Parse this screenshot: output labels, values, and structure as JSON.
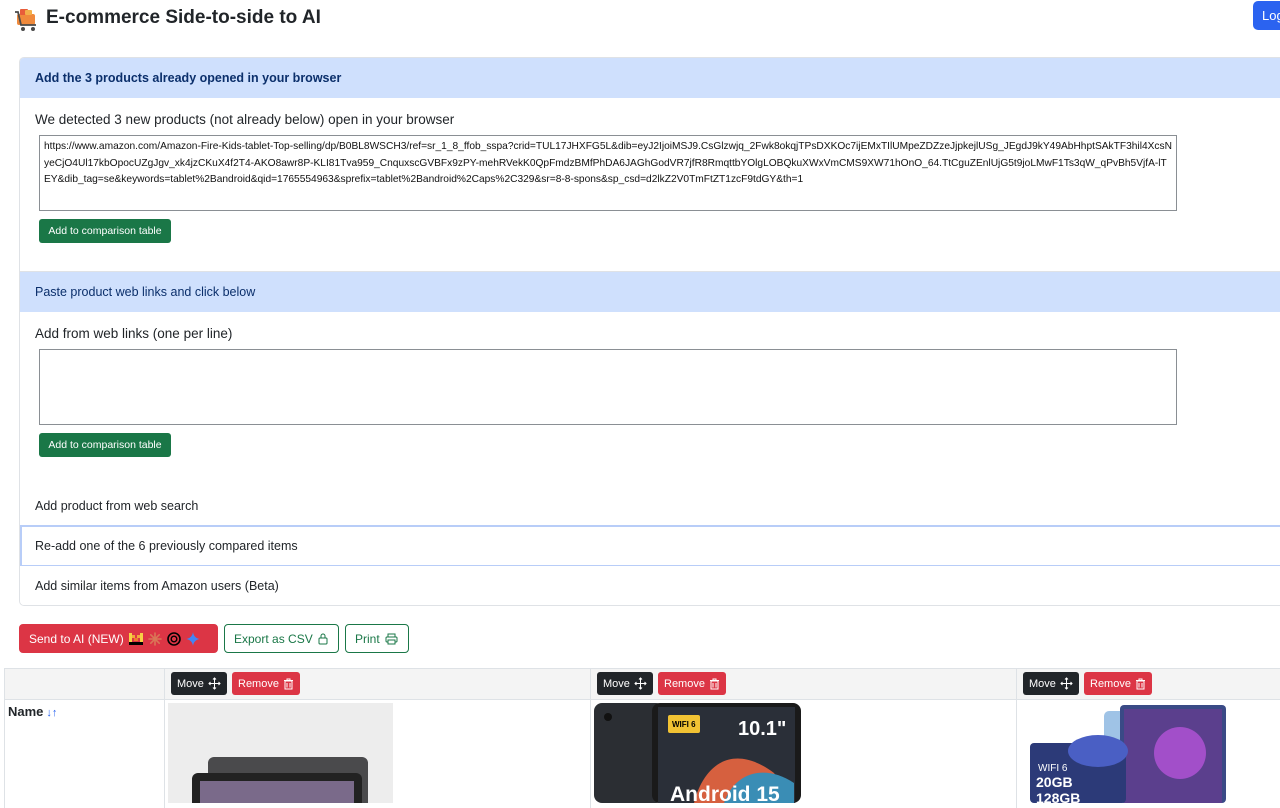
{
  "header": {
    "title": "E-commerce Side-to-side to AI",
    "login_label": "Login"
  },
  "sections": {
    "opened": {
      "heading": "Add the 3 products already opened in your browser",
      "detected_text": "We detected 3 new products (not already below) open in your browser",
      "urls": "https://www.amazon.com/Amazon-Fire-Kids-tablet-Top-selling/dp/B0BL8WSCH3/ref=sr_1_8_ffob_sspa?crid=TUL17JHXFG5L&dib=eyJ2IjoiMSJ9.CsGlzwjq_2Fwk8okqjTPsDXKOc7ijEMxTIlUMpeZDZzeJjpkejlUSg_JEgdJ9kY49AbHhptSAkTF3hil4XcsNyeCjO4Ul17kbOpocUZgJgv_xk4jzCKuX4f2T4-AKO8awr8P-KLI81Tva959_CnquxscGVBFx9zPY-mehRVekK0QpFmdzBMfPhDA6JAGhGodVR7jfR8RmqttbYOlgLOBQkuXWxVmCMS9XW71hOnO_64.TtCguZEnlUjG5t9joLMwF1Ts3qW_qPvBh5VjfA-lTEY&dib_tag=se&keywords=tablet%2Bandroid&qid=1765554963&sprefix=tablet%2Bandroid%2Caps%2C329&sr=8-8-spons&sp_csd=d2lkZ2V0TmFtZT1zcF9tdGY&th=1",
      "button_label": "Add to comparison table"
    },
    "paste": {
      "heading": "Paste product web links and click below",
      "label": "Add from web links (one per line)",
      "value": "",
      "button_label": "Add to comparison table"
    },
    "web_search": {
      "heading": "Add product from web search"
    },
    "readd": {
      "heading": "Re-add one of the 6 previously compared items"
    },
    "similar": {
      "heading": "Add similar items from Amazon users (Beta)"
    }
  },
  "toolbar": {
    "send_ai_label": "Send to AI (NEW)",
    "export_label": "Export as CSV",
    "print_label": "Print"
  },
  "table": {
    "move_label": "Move",
    "remove_label": "Remove",
    "name_header": "Name",
    "products": [
      {
        "badge": "",
        "size": ""
      },
      {
        "badge": "WIFI 6",
        "size": "10.1\"",
        "os": "Android 15"
      },
      {
        "badge": "WIFI 6",
        "ram": "20GB",
        "rom": "128GB"
      }
    ]
  },
  "colors": {
    "accent": "#2b63f0",
    "green": "#1a7747",
    "red": "#dc3545",
    "accordion_active": "#cfe0fd"
  }
}
